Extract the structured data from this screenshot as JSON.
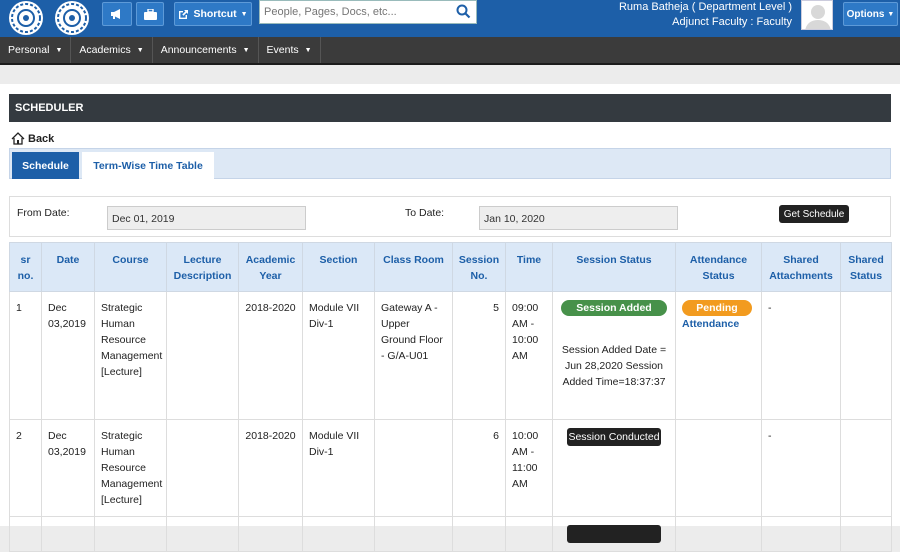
{
  "header": {
    "search_placeholder": "People, Pages, Docs, etc...",
    "shortcut_label": "Shortcut",
    "user_name": "Ruma Batheja ( Department Level )",
    "user_role": "Adjunct Faculty : Faculty",
    "options_label": "Options",
    "brand_color": "#1d5fa8"
  },
  "menu": {
    "items": [
      {
        "label": "Personal"
      },
      {
        "label": "Academics"
      },
      {
        "label": "Announcements"
      },
      {
        "label": "Events"
      }
    ]
  },
  "page": {
    "title": "SCHEDULER",
    "back_label": "Back",
    "tabs": [
      "Schedule",
      "Term-Wise Time Table"
    ]
  },
  "filter": {
    "from_label": "From Date:",
    "from_value": "Dec 01, 2019",
    "to_label": "To Date:",
    "to_value": "Jan 10, 2020",
    "get_button": "Get Schedule"
  },
  "table": {
    "headers": {
      "sr": "sr no.",
      "date": "Date",
      "course": "Course",
      "lecture": "Lecture Description",
      "year": "Academic Year",
      "section": "Section",
      "room": "Class Room",
      "session": "Session No.",
      "time": "Time",
      "status": "Session Status",
      "attendance": "Attendance Status",
      "attachments": "Shared Attachments",
      "shared_status": "Shared Status"
    },
    "rows": [
      {
        "sr": "1",
        "date": "Dec 03,2019",
        "course": "Strategic Human Resource Management [Lecture]",
        "lecture": "",
        "year": "2018-2020",
        "section": "Module VII Div-1",
        "room": "Gateway A - Upper Ground Floor - G/A-U01",
        "session": "5",
        "time": "09:00 AM - 10:00 AM",
        "status_badge": "Session Added",
        "status_detail": "Session Added Date = Jun 28,2020 Session Added Time=18:37:37",
        "attendance_badge": "Pending",
        "attendance_link": "Attendance",
        "attachments": "-",
        "shared_status": ""
      },
      {
        "sr": "2",
        "date": "Dec 03,2019",
        "course": "Strategic Human Resource Management [Lecture]",
        "lecture": "",
        "year": "2018-2020",
        "section": "Module VII Div-1",
        "room": "",
        "session": "6",
        "time": "10:00 AM - 11:00 AM",
        "status_badge": "Session Conducted",
        "attachments": "-",
        "shared_status": ""
      }
    ]
  }
}
